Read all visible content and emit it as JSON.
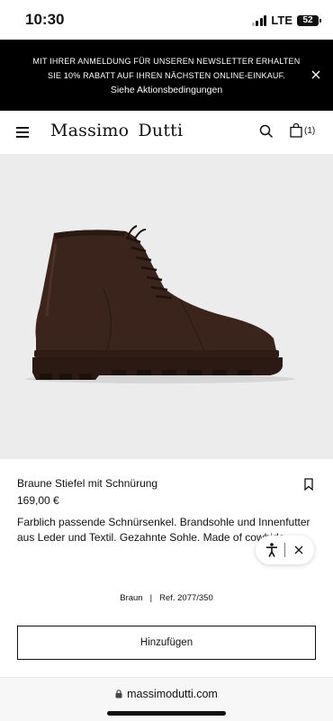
{
  "status_bar": {
    "time": "10:30",
    "network": "LTE",
    "battery": "52"
  },
  "promo": {
    "line1": "MIT IHRER ANMELDUNG FÜR UNSEREN NEWSLETTER ERHALTEN",
    "line2": "SIE 10% RABATT AUF IHREN NÄCHSTEN ONLINE-EINKAUF.",
    "link": "Siehe Aktionsbedingungen"
  },
  "header": {
    "logo": "Massimo Dutti",
    "bag_count": "(1)"
  },
  "product": {
    "name": "Braune Stiefel mit Schnürung",
    "price": "169,00 €",
    "description": "Farblich passende Schnürsenkel. Brandsohle und Innenfutter aus Leder und Textil. Gezahnte Sohle. Made of cowhide leather.",
    "color": "Braun",
    "reference": "Ref. 2077/350",
    "add_button": "Hinzufügen"
  },
  "browser": {
    "url": "massimodutti.com"
  },
  "colors": {
    "banner_bg": "#000000",
    "image_bg": "#ececec",
    "boot_brown": "#3a241c"
  }
}
